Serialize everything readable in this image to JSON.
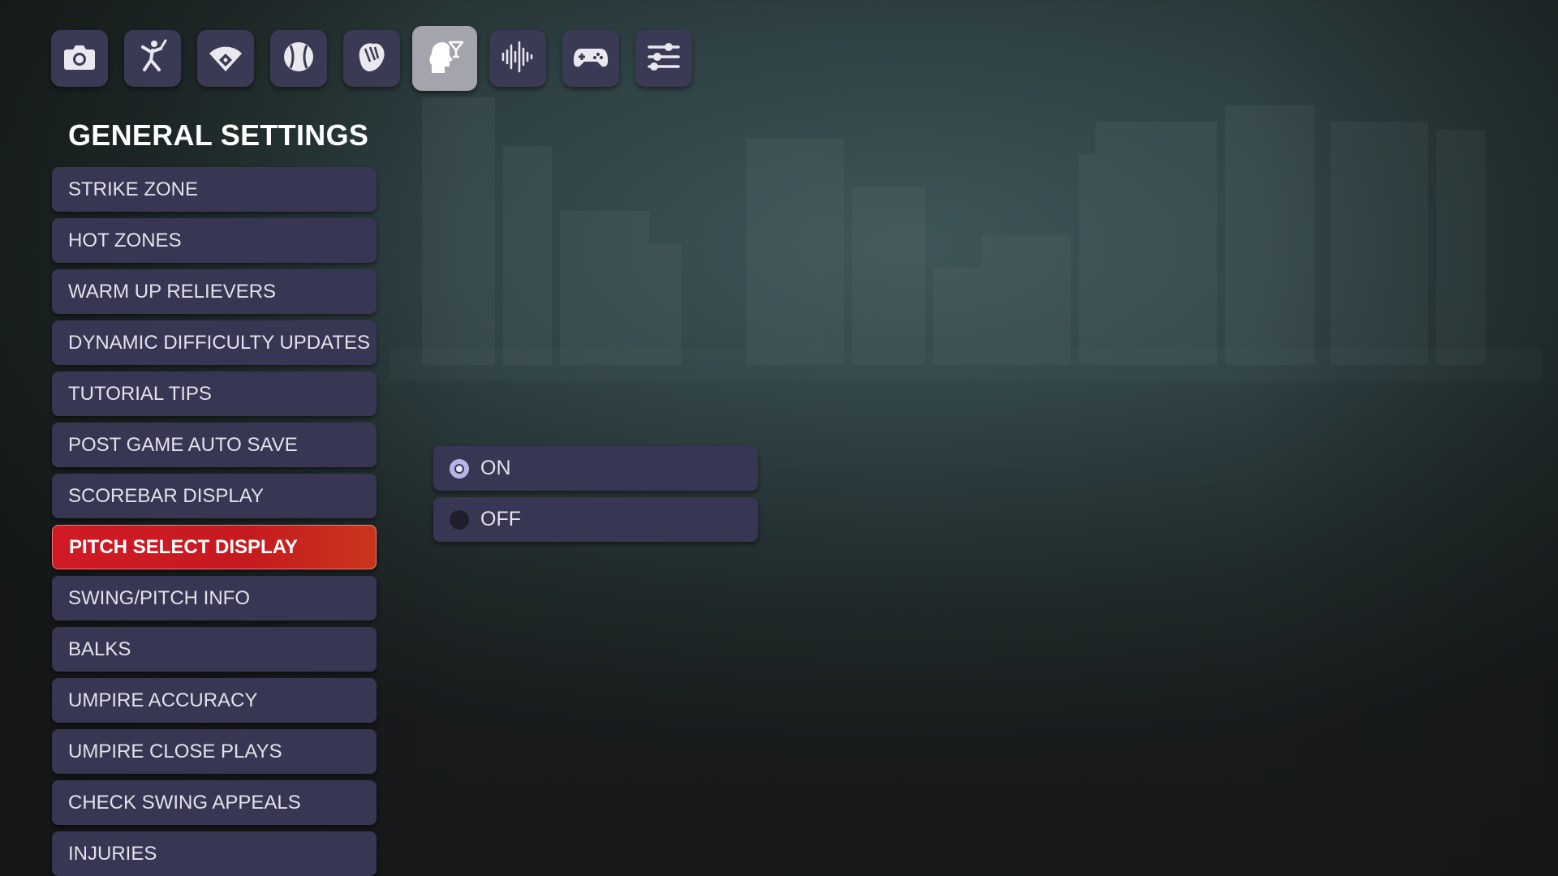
{
  "tabs": [
    {
      "icon": "camera-icon",
      "active": false
    },
    {
      "icon": "batter-icon",
      "active": false
    },
    {
      "icon": "baseball-field-icon",
      "active": false
    },
    {
      "icon": "baseball-icon",
      "active": false
    },
    {
      "icon": "baseball-glove-icon",
      "active": false
    },
    {
      "icon": "head-gameplay-icon",
      "active": true
    },
    {
      "icon": "audio-waveform-icon",
      "active": false
    },
    {
      "icon": "gamepad-icon",
      "active": false
    },
    {
      "icon": "sliders-icon",
      "active": false
    }
  ],
  "section_title": "GENERAL SETTINGS",
  "settings": [
    {
      "label": "STRIKE ZONE"
    },
    {
      "label": "HOT ZONES"
    },
    {
      "label": "WARM UP RELIEVERS"
    },
    {
      "label": "DYNAMIC DIFFICULTY UPDATES"
    },
    {
      "label": "TUTORIAL TIPS"
    },
    {
      "label": "POST GAME AUTO SAVE"
    },
    {
      "label": "SCOREBAR DISPLAY"
    },
    {
      "label": "PITCH SELECT DISPLAY",
      "selected": true
    },
    {
      "label": "SWING/PITCH INFO"
    },
    {
      "label": "BALKS"
    },
    {
      "label": "UMPIRE ACCURACY"
    },
    {
      "label": "UMPIRE CLOSE PLAYS"
    },
    {
      "label": "CHECK SWING APPEALS"
    },
    {
      "label": "INJURIES"
    }
  ],
  "options": [
    {
      "label": "ON",
      "selected": true
    },
    {
      "label": "OFF",
      "selected": false
    }
  ],
  "colors": {
    "item_bg": "#373753",
    "active_item": "#d11a26",
    "active_tab": "#a4a4ac",
    "radio_selected": "#b7b4e8"
  }
}
